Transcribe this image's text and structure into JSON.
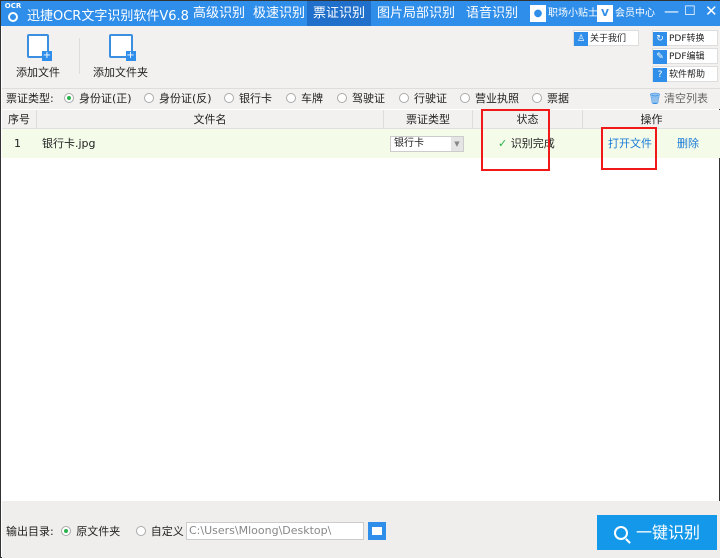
{
  "app": {
    "logo_text": "OCR",
    "title": "迅捷OCR文字识别软件V6.8"
  },
  "tabs": [
    {
      "label": "高级识别"
    },
    {
      "label": "极速识别"
    },
    {
      "label": "票证识别",
      "active": true
    },
    {
      "label": "图片局部识别"
    },
    {
      "label": "语音识别"
    }
  ],
  "titlebar": {
    "tips": "职场小贴士",
    "member": "会员中心",
    "member_badge": "V",
    "minimize": "—",
    "maximize": "☐",
    "close": "✕"
  },
  "toolbar": {
    "add_file": "添加文件",
    "add_folder": "添加文件夹",
    "about": "关于我们",
    "pdf_convert": "PDF转换",
    "pdf_edit": "PDF编辑",
    "help": "软件帮助"
  },
  "ticket_types": {
    "label": "票证类型:",
    "options": [
      "身份证(正)",
      "身份证(反)",
      "银行卡",
      "车牌",
      "驾驶证",
      "行驶证",
      "营业执照",
      "票据"
    ],
    "selected": 0,
    "clear": "清空列表"
  },
  "table": {
    "headers": [
      "序号",
      "文件名",
      "票证类型",
      "状态",
      "操作"
    ],
    "rows": [
      {
        "index": "1",
        "filename": "银行卡.jpg",
        "type": "银行卡",
        "status": "识别完成",
        "open": "打开文件",
        "delete": "删除"
      }
    ]
  },
  "output": {
    "label": "输出目录:",
    "option_original": "原文件夹",
    "option_custom": "自定义",
    "selected": "原文件夹",
    "path": "C:\\Users\\Mloong\\Desktop\\"
  },
  "action": {
    "recognize": "一键识别"
  },
  "colors": {
    "accent": "#2f8ee9",
    "active_tab": "#1f6fcb",
    "highlight": "#f01818",
    "success": "#2bb24c"
  }
}
